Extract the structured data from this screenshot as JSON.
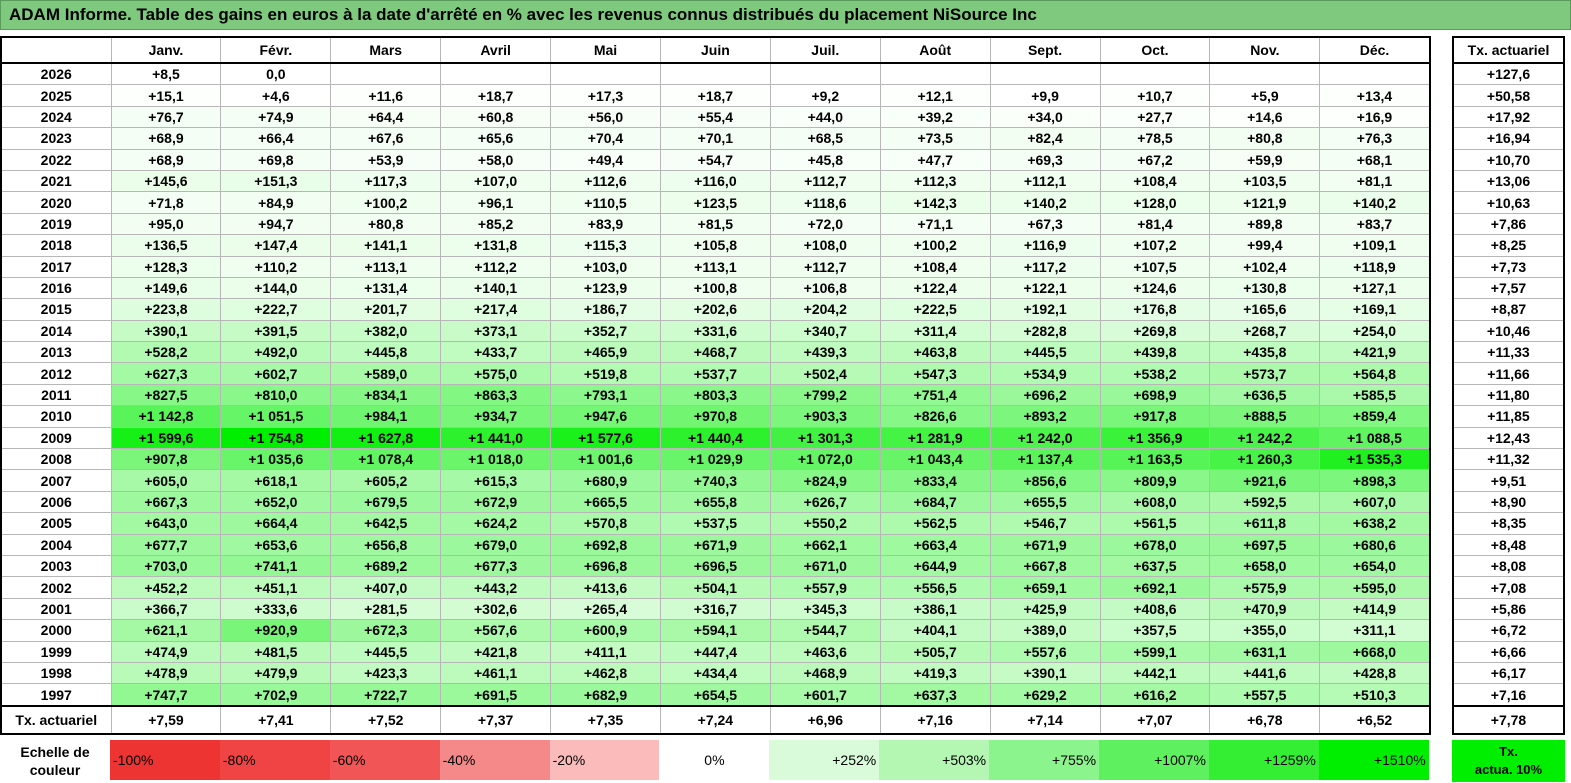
{
  "title": "ADAM Informe. Table des gains en euros à la date d'arrêté en % avec les revenus connus distribués du placement NiSource Inc",
  "chart_data": {
    "type": "heatmap",
    "columns": [
      "Janv.",
      "Févr.",
      "Mars",
      "Avril",
      "Mai",
      "Juin",
      "Juil.",
      "Août",
      "Sept.",
      "Oct.",
      "Nov.",
      "Déc."
    ],
    "side_header": "Tx. actuariel",
    "rows": [
      {
        "year": "2026",
        "values": [
          "+8,5",
          "0,0",
          "",
          "",
          "",
          "",
          "",
          "",
          "",
          "",
          "",
          ""
        ],
        "tx": "+127,6"
      },
      {
        "year": "2025",
        "values": [
          "+15,1",
          "+4,6",
          "+11,6",
          "+18,7",
          "+17,3",
          "+18,7",
          "+9,2",
          "+12,1",
          "+9,9",
          "+10,7",
          "+5,9",
          "+13,4"
        ],
        "tx": "+50,58"
      },
      {
        "year": "2024",
        "values": [
          "+76,7",
          "+74,9",
          "+64,4",
          "+60,8",
          "+56,0",
          "+55,4",
          "+44,0",
          "+39,2",
          "+34,0",
          "+27,7",
          "+14,6",
          "+16,9"
        ],
        "tx": "+17,92"
      },
      {
        "year": "2023",
        "values": [
          "+68,9",
          "+66,4",
          "+67,6",
          "+65,6",
          "+70,4",
          "+70,1",
          "+68,5",
          "+73,5",
          "+82,4",
          "+78,5",
          "+80,8",
          "+76,3"
        ],
        "tx": "+16,94"
      },
      {
        "year": "2022",
        "values": [
          "+68,9",
          "+69,8",
          "+53,9",
          "+58,0",
          "+49,4",
          "+54,7",
          "+45,8",
          "+47,7",
          "+69,3",
          "+67,2",
          "+59,9",
          "+68,1"
        ],
        "tx": "+10,70"
      },
      {
        "year": "2021",
        "values": [
          "+145,6",
          "+151,3",
          "+117,3",
          "+107,0",
          "+112,6",
          "+116,0",
          "+112,7",
          "+112,3",
          "+112,1",
          "+108,4",
          "+103,5",
          "+81,1"
        ],
        "tx": "+13,06"
      },
      {
        "year": "2020",
        "values": [
          "+71,8",
          "+84,9",
          "+100,2",
          "+96,1",
          "+110,5",
          "+123,5",
          "+118,6",
          "+142,3",
          "+140,2",
          "+128,0",
          "+121,9",
          "+140,2"
        ],
        "tx": "+10,63"
      },
      {
        "year": "2019",
        "values": [
          "+95,0",
          "+94,7",
          "+80,8",
          "+85,2",
          "+83,9",
          "+81,5",
          "+72,0",
          "+71,1",
          "+67,3",
          "+81,4",
          "+89,8",
          "+83,7"
        ],
        "tx": "+7,86"
      },
      {
        "year": "2018",
        "values": [
          "+136,5",
          "+147,4",
          "+141,1",
          "+131,8",
          "+115,3",
          "+105,8",
          "+108,0",
          "+100,2",
          "+116,9",
          "+107,2",
          "+99,4",
          "+109,1"
        ],
        "tx": "+8,25"
      },
      {
        "year": "2017",
        "values": [
          "+128,3",
          "+110,2",
          "+113,1",
          "+112,2",
          "+103,0",
          "+113,1",
          "+112,7",
          "+108,4",
          "+117,2",
          "+107,5",
          "+102,4",
          "+118,9"
        ],
        "tx": "+7,73"
      },
      {
        "year": "2016",
        "values": [
          "+149,6",
          "+144,0",
          "+131,4",
          "+140,1",
          "+123,9",
          "+100,8",
          "+106,8",
          "+122,4",
          "+122,1",
          "+124,6",
          "+130,8",
          "+127,1"
        ],
        "tx": "+7,57"
      },
      {
        "year": "2015",
        "values": [
          "+223,8",
          "+222,7",
          "+201,7",
          "+217,4",
          "+186,7",
          "+202,6",
          "+204,2",
          "+222,5",
          "+192,1",
          "+176,8",
          "+165,6",
          "+169,1"
        ],
        "tx": "+8,87"
      },
      {
        "year": "2014",
        "values": [
          "+390,1",
          "+391,5",
          "+382,0",
          "+373,1",
          "+352,7",
          "+331,6",
          "+340,7",
          "+311,4",
          "+282,8",
          "+269,8",
          "+268,7",
          "+254,0"
        ],
        "tx": "+10,46"
      },
      {
        "year": "2013",
        "values": [
          "+528,2",
          "+492,0",
          "+445,8",
          "+433,7",
          "+465,9",
          "+468,7",
          "+439,3",
          "+463,8",
          "+445,5",
          "+439,8",
          "+435,8",
          "+421,9"
        ],
        "tx": "+11,33"
      },
      {
        "year": "2012",
        "values": [
          "+627,3",
          "+602,7",
          "+589,0",
          "+575,0",
          "+519,8",
          "+537,7",
          "+502,4",
          "+547,3",
          "+534,9",
          "+538,2",
          "+573,7",
          "+564,8"
        ],
        "tx": "+11,66"
      },
      {
        "year": "2011",
        "values": [
          "+827,5",
          "+810,0",
          "+834,1",
          "+863,3",
          "+793,1",
          "+803,3",
          "+799,2",
          "+751,4",
          "+696,2",
          "+698,9",
          "+636,5",
          "+585,5"
        ],
        "tx": "+11,80"
      },
      {
        "year": "2010",
        "values": [
          "+1 142,8",
          "+1 051,5",
          "+984,1",
          "+934,7",
          "+947,6",
          "+970,8",
          "+903,3",
          "+826,6",
          "+893,2",
          "+917,8",
          "+888,5",
          "+859,4"
        ],
        "tx": "+11,85"
      },
      {
        "year": "2009",
        "values": [
          "+1 599,6",
          "+1 754,8",
          "+1 627,8",
          "+1 441,0",
          "+1 577,6",
          "+1 440,4",
          "+1 301,3",
          "+1 281,9",
          "+1 242,0",
          "+1 356,9",
          "+1 242,2",
          "+1 088,5"
        ],
        "tx": "+12,43"
      },
      {
        "year": "2008",
        "values": [
          "+907,8",
          "+1 035,6",
          "+1 078,4",
          "+1 018,0",
          "+1 001,6",
          "+1 029,9",
          "+1 072,0",
          "+1 043,4",
          "+1 137,4",
          "+1 163,5",
          "+1 260,3",
          "+1 535,3"
        ],
        "tx": "+11,32"
      },
      {
        "year": "2007",
        "values": [
          "+605,0",
          "+618,1",
          "+605,2",
          "+615,3",
          "+680,9",
          "+740,3",
          "+824,9",
          "+833,4",
          "+856,6",
          "+809,9",
          "+921,6",
          "+898,3"
        ],
        "tx": "+9,51"
      },
      {
        "year": "2006",
        "values": [
          "+667,3",
          "+652,0",
          "+679,5",
          "+672,9",
          "+665,5",
          "+655,8",
          "+626,7",
          "+684,7",
          "+655,5",
          "+608,0",
          "+592,5",
          "+607,0"
        ],
        "tx": "+8,90"
      },
      {
        "year": "2005",
        "values": [
          "+643,0",
          "+664,4",
          "+642,5",
          "+624,2",
          "+570,8",
          "+537,5",
          "+550,2",
          "+562,5",
          "+546,7",
          "+561,5",
          "+611,8",
          "+638,2"
        ],
        "tx": "+8,35"
      },
      {
        "year": "2004",
        "values": [
          "+677,7",
          "+653,6",
          "+656,8",
          "+679,0",
          "+692,8",
          "+671,9",
          "+662,1",
          "+663,4",
          "+671,9",
          "+678,0",
          "+697,5",
          "+680,6"
        ],
        "tx": "+8,48"
      },
      {
        "year": "2003",
        "values": [
          "+703,0",
          "+741,1",
          "+689,2",
          "+677,3",
          "+696,8",
          "+696,5",
          "+671,0",
          "+644,9",
          "+667,8",
          "+637,5",
          "+658,0",
          "+654,0"
        ],
        "tx": "+8,08"
      },
      {
        "year": "2002",
        "values": [
          "+452,2",
          "+451,1",
          "+407,0",
          "+443,2",
          "+413,6",
          "+504,1",
          "+557,9",
          "+556,5",
          "+659,1",
          "+692,1",
          "+575,9",
          "+595,0"
        ],
        "tx": "+7,08"
      },
      {
        "year": "2001",
        "values": [
          "+366,7",
          "+333,6",
          "+281,5",
          "+302,6",
          "+265,4",
          "+316,7",
          "+345,3",
          "+386,1",
          "+425,9",
          "+408,6",
          "+470,9",
          "+414,9"
        ],
        "tx": "+5,86"
      },
      {
        "year": "2000",
        "values": [
          "+621,1",
          "+920,9",
          "+672,3",
          "+567,6",
          "+600,9",
          "+594,1",
          "+544,7",
          "+404,1",
          "+389,0",
          "+357,5",
          "+355,0",
          "+311,1"
        ],
        "tx": "+6,72"
      },
      {
        "year": "1999",
        "values": [
          "+474,9",
          "+481,5",
          "+445,5",
          "+421,8",
          "+411,1",
          "+447,4",
          "+463,6",
          "+505,7",
          "+557,6",
          "+599,1",
          "+631,1",
          "+668,0"
        ],
        "tx": "+6,66"
      },
      {
        "year": "1998",
        "values": [
          "+478,9",
          "+479,9",
          "+423,3",
          "+461,1",
          "+462,8",
          "+434,4",
          "+468,9",
          "+419,3",
          "+390,1",
          "+442,1",
          "+441,6",
          "+428,8"
        ],
        "tx": "+6,17"
      },
      {
        "year": "1997",
        "values": [
          "+747,7",
          "+702,9",
          "+722,7",
          "+691,5",
          "+682,9",
          "+654,5",
          "+601,7",
          "+637,3",
          "+629,2",
          "+616,2",
          "+557,5",
          "+510,3"
        ],
        "tx": "+7,16"
      }
    ],
    "footer": {
      "label": "Tx. actuariel",
      "values": [
        "+7,59",
        "+7,41",
        "+7,52",
        "+7,37",
        "+7,35",
        "+7,24",
        "+6,96",
        "+7,16",
        "+7,14",
        "+7,07",
        "+6,78",
        "+6,52"
      ],
      "tx": "+7,78"
    }
  },
  "legend": {
    "label_line1": "Echelle de",
    "label_line2": "couleur",
    "cells": [
      {
        "text": "-100%",
        "color": "#ee3333",
        "align": "left"
      },
      {
        "text": "-80%",
        "color": "#f04444",
        "align": "left"
      },
      {
        "text": "-60%",
        "color": "#f25555",
        "align": "left"
      },
      {
        "text": "-40%",
        "color": "#f58888",
        "align": "left"
      },
      {
        "text": "-20%",
        "color": "#fbbbbb",
        "align": "left"
      },
      {
        "text": "0%",
        "color": "#ffffff",
        "align": "center"
      },
      {
        "text": "+252%",
        "color": "#d9fbd9",
        "align": "right"
      },
      {
        "text": "+503%",
        "color": "#b3f7b3",
        "align": "right"
      },
      {
        "text": "+755%",
        "color": "#8cf48c",
        "align": "right"
      },
      {
        "text": "+1007%",
        "color": "#5ff05f",
        "align": "right"
      },
      {
        "text": "+1259%",
        "color": "#33ee33",
        "align": "right"
      },
      {
        "text": "+1510%",
        "color": "#00ee00",
        "align": "right"
      }
    ],
    "tx_line1": "Tx.",
    "tx_line2": "actua. 10%"
  }
}
